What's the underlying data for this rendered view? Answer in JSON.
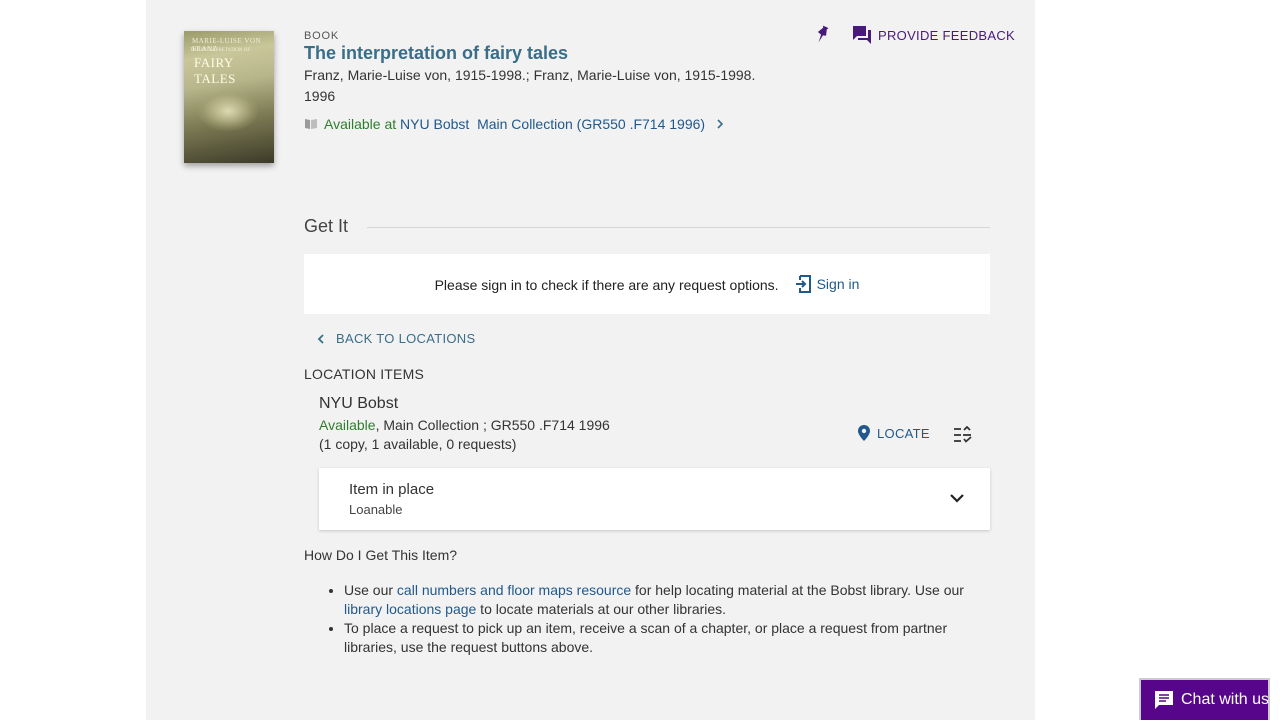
{
  "record": {
    "type_label": "BOOK",
    "title": "The interpretation of fairy tales",
    "authors": "Franz, Marie-Luise von, 1915-1998.; Franz, Marie-Luise von, 1915-1998.",
    "year": "1996",
    "availability": {
      "status": "Available at",
      "library": "NYU Bobst",
      "location": "Main Collection",
      "call_number": "(GR550 .F714 1996)"
    },
    "cover": {
      "line1": "MARIE-LUISE VON FRANZ",
      "line2": "THE INTERPRETATION OF",
      "line3": "FAIRY TALES"
    }
  },
  "top_actions": {
    "pin_icon": "pin-icon",
    "feedback_label": "PROVIDE FEEDBACK"
  },
  "get_it": {
    "heading": "Get It",
    "signin_prompt": "Please sign in to check if there are any request options.",
    "signin_label": "Sign in",
    "back_label": "BACK TO LOCATIONS",
    "location_items_label": "LOCATION ITEMS",
    "library": {
      "name": "NYU Bobst",
      "status": "Available",
      "details": ", Main Collection ; GR550 .F714 1996",
      "copies": "(1 copy, 1 available, 0 requests)",
      "locate_label": "LOCATE"
    },
    "item": {
      "title": "Item in place",
      "subtitle": "Loanable"
    }
  },
  "how_to": {
    "heading": "How Do I Get This Item?",
    "bullet1": {
      "pre": "Use our ",
      "link1": "call numbers and floor maps resource",
      "mid": " for help locating material at the Bobst library. Use our ",
      "link2": "library locations page",
      "post": " to locate materials at our other libraries."
    },
    "bullet2": "To place a request to pick up an item, receive a scan of a chapter, or place a request from partner libraries, use the request buttons above."
  },
  "chat": {
    "label": "Chat with us"
  },
  "colors": {
    "panel_bg": "#f2f2f2",
    "link": "#21598c",
    "title": "#3a6d88",
    "available_green": "#2e7d2e",
    "brand_purple": "#57068c"
  }
}
